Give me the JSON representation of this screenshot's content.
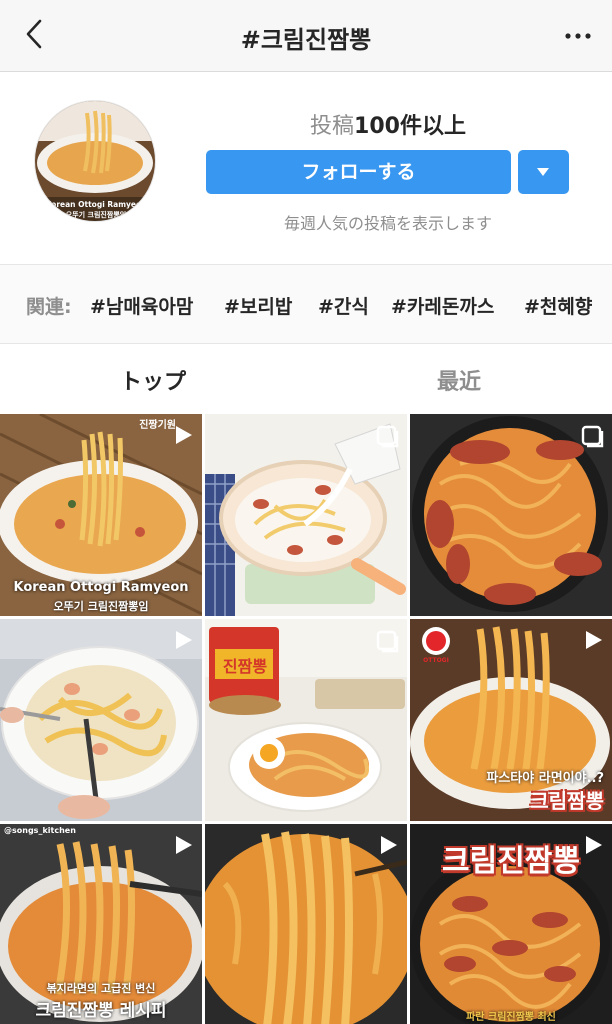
{
  "header": {
    "title": "#크림진짬뽕",
    "back_icon": "chevron-left-icon",
    "more_icon": "more-horizontal-icon"
  },
  "profile": {
    "avatar_caption_line1": "Korean Ottogi Ramyeon",
    "avatar_caption_line2": "오뚜기 크림진짬뽕임",
    "posts_label": "投稿",
    "posts_count": "100件以上",
    "follow_label": "フォローする",
    "weekly_text": "毎週人気の投稿を表示します"
  },
  "related": {
    "label": "関連:",
    "tags": [
      "#남매육아맘",
      "#보리밥",
      "#간식",
      "#카레돈까스",
      "#천혜향"
    ]
  },
  "tabs": {
    "top": "トップ",
    "recent": "最近"
  },
  "posts": [
    {
      "caption1": "Korean Ottogi Ramyeon",
      "caption2": "오뚜기 크림진짬뽕임",
      "corner_text": "진짱기원",
      "badge": "video-icon"
    },
    {
      "badge": "multi-image-icon"
    },
    {
      "badge": "multi-image-icon"
    },
    {
      "badge": "video-icon"
    },
    {
      "package_text": "진짬뽕",
      "badge": "multi-image-icon"
    },
    {
      "brand_text": "OTTOGI",
      "caption1": "파스타야 라면이야..?",
      "caption2": "크림짬뽕",
      "badge": "video-icon"
    },
    {
      "handle": "@songs_kitchen",
      "caption1": "볶지라면의 고급진 변신",
      "caption2": "크림진짬뽕 레시피",
      "badge": "video-icon"
    },
    {
      "badge": "video-icon"
    },
    {
      "title_text": "크림진짬뽕",
      "footer_text": "파란 크림진짬뽕 최신",
      "badge": "video-icon"
    }
  ],
  "colors": {
    "accent": "#3897f0",
    "muted": "#8e8e8e",
    "text": "#262626"
  }
}
